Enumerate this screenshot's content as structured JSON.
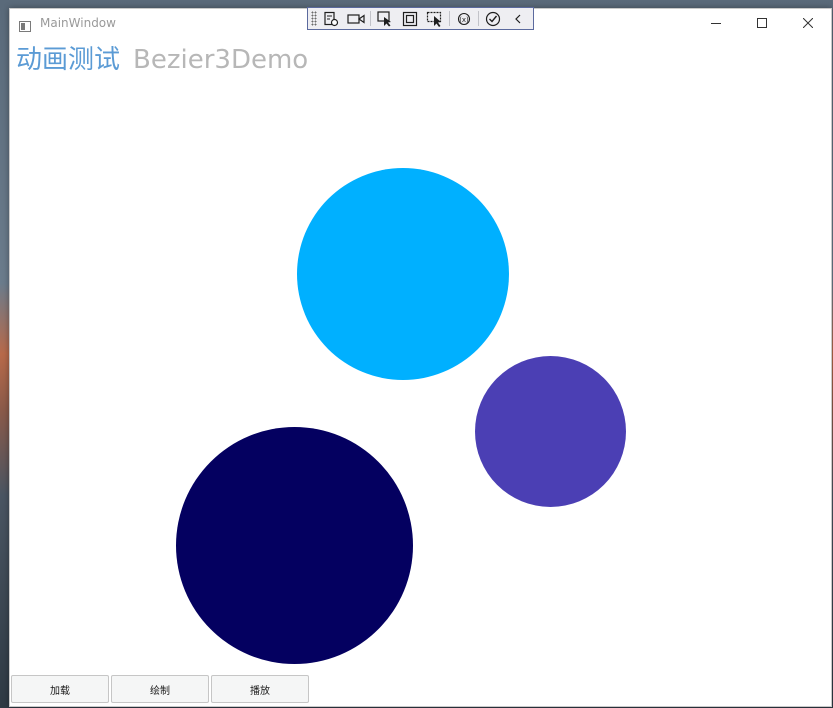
{
  "window": {
    "title": "MainWindow"
  },
  "debug_toolbar": {
    "icons": [
      "live-visual-tree-icon",
      "record-icon",
      "select-element-icon",
      "display-layout-adorners-icon",
      "track-focus-icon",
      "hot-reload-icon",
      "binding-failures-icon",
      "collapse-icon"
    ]
  },
  "heading": {
    "main": "动画测试",
    "sub": "Bezier3Demo"
  },
  "circles": [
    {
      "name": "light-blue-circle",
      "color": "#00b0ff"
    },
    {
      "name": "purple-circle",
      "color": "#4b3fb4"
    },
    {
      "name": "navy-circle",
      "color": "#040060"
    }
  ],
  "buttons": {
    "load": "加载",
    "draw": "绘制",
    "play": "播放"
  }
}
